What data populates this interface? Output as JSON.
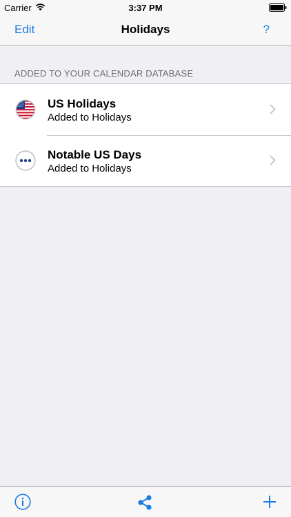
{
  "status_bar": {
    "carrier": "Carrier",
    "time": "3:37 PM"
  },
  "nav": {
    "edit_label": "Edit",
    "title": "Holidays",
    "help_label": "?"
  },
  "section": {
    "header": "ADDED TO YOUR CALENDAR DATABASE"
  },
  "list": {
    "items": [
      {
        "title": "US Holidays",
        "subtitle": "Added to Holidays",
        "icon": "us-flag-icon"
      },
      {
        "title": "Notable US Days",
        "subtitle": "Added to Holidays",
        "icon": "ellipsis-icon"
      }
    ]
  },
  "toolbar": {
    "icons": [
      "info-icon",
      "share-icon",
      "plus-icon"
    ]
  },
  "colors": {
    "accent": "#1a7be0",
    "background": "#efeff4",
    "bar": "#f7f7f7"
  }
}
